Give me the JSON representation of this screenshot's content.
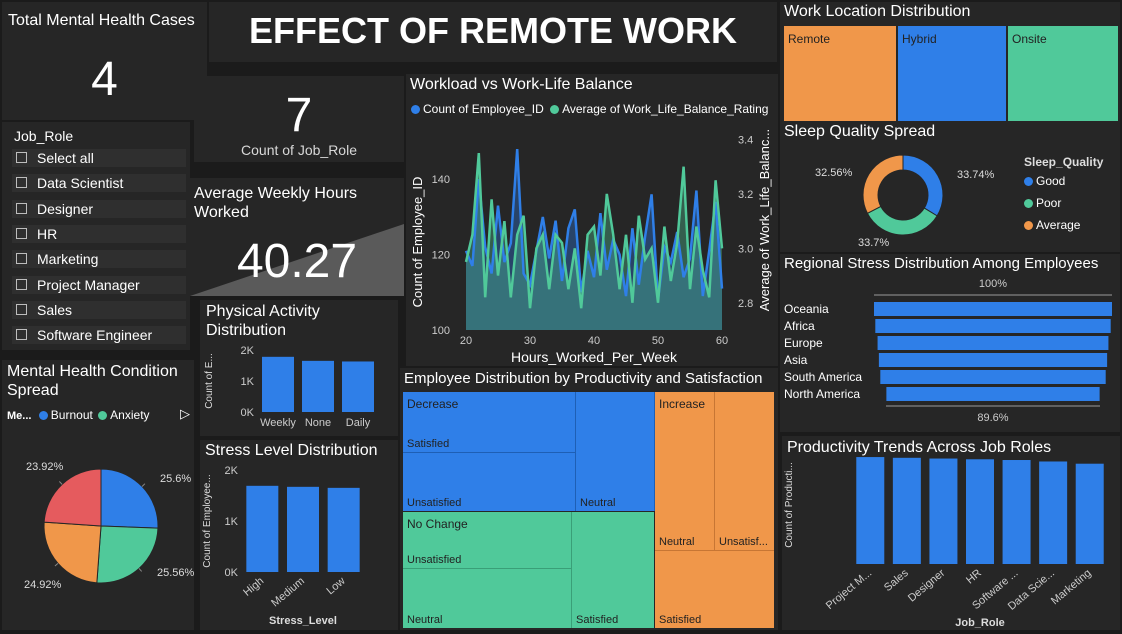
{
  "colors": {
    "blue": "#2f7fe8",
    "green": "#50c99a",
    "orange": "#f0974a",
    "red": "#e55b5e"
  },
  "header": {
    "title": "EFFECT OF REMOTE WORK"
  },
  "kpi_cases": {
    "label": "Total Mental Health Cases",
    "value": "4"
  },
  "kpi_roles": {
    "value": "7",
    "label": "Count of Job_Role"
  },
  "kpi_hours": {
    "label": "Average Weekly Hours Worked",
    "value": "40.27"
  },
  "slicer": {
    "title": "Job_Role",
    "items": [
      "Select all",
      "Data Scientist",
      "Designer",
      "HR",
      "Marketing",
      "Project Manager",
      "Sales",
      "Software Engineer"
    ]
  },
  "mental_health": {
    "title": "Mental Health Condition Spread",
    "legend_title": "Me...",
    "legend": [
      "Burnout",
      "Anxiety"
    ],
    "chart_data": {
      "type": "pie",
      "labels": [
        "25.6%",
        "25.56%",
        "24.92%",
        "23.92%"
      ],
      "values": [
        25.6,
        25.56,
        24.92,
        23.92
      ],
      "colors": [
        "#2f7fe8",
        "#50c99a",
        "#f0974a",
        "#e55b5e"
      ]
    }
  },
  "physical": {
    "title": "Physical Activity Distribution",
    "chart_data": {
      "type": "bar",
      "categories": [
        "Weekly",
        "None",
        "Daily"
      ],
      "values": [
        1780,
        1650,
        1630
      ],
      "ylabel": "Count of E...",
      "yticks": [
        "0K",
        "1K",
        "2K"
      ],
      "ylim": [
        0,
        2000
      ]
    }
  },
  "stress": {
    "title": "Stress Level Distribution",
    "chart_data": {
      "type": "bar",
      "categories": [
        "High",
        "Medium",
        "Low"
      ],
      "values": [
        1690,
        1670,
        1650
      ],
      "xlabel": "Stress_Level",
      "ylabel": "Count of Employee...",
      "yticks": [
        "0K",
        "1K",
        "2K"
      ],
      "ylim": [
        0,
        2000
      ]
    }
  },
  "workload": {
    "title": "Workload vs Work-Life Balance",
    "legend": [
      "Count of Employee_ID",
      "Average of Work_Life_Balance_Rating"
    ],
    "chart_data": {
      "type": "line",
      "x": [
        20,
        21,
        22,
        23,
        24,
        25,
        26,
        27,
        28,
        29,
        30,
        31,
        32,
        33,
        34,
        35,
        36,
        37,
        38,
        39,
        40,
        41,
        42,
        43,
        44,
        45,
        46,
        47,
        48,
        49,
        50,
        51,
        52,
        53,
        54,
        55,
        56,
        57,
        58,
        59,
        60
      ],
      "series": [
        {
          "name": "Count of Employee_ID",
          "axis": "left",
          "values": [
            121,
            117,
            140,
            122,
            115,
            133,
            118,
            123,
            148,
            115,
            112,
            121,
            130,
            119,
            129,
            113,
            127,
            132,
            110,
            121,
            114,
            131,
            116,
            124,
            120,
            109,
            127,
            112,
            125,
            136,
            108,
            122,
            118,
            126,
            114,
            119,
            137,
            109,
            121,
            134,
            111
          ]
        },
        {
          "name": "Average of Work_Life_Balance_Rating",
          "axis": "right",
          "values": [
            2.95,
            3.05,
            3.35,
            2.82,
            3.18,
            2.9,
            3.1,
            2.82,
            3.05,
            3.12,
            2.78,
            3.0,
            3.05,
            2.85,
            3.05,
            3.02,
            2.85,
            3.0,
            2.78,
            3.05,
            3.08,
            2.9,
            3.2,
            3.05,
            2.85,
            3.05,
            2.8,
            3.12,
            2.96,
            3.0,
            2.8,
            3.08,
            2.88,
            3.02,
            3.3,
            2.85,
            3.08,
            2.92,
            2.82,
            3.25,
            3.0
          ]
        }
      ],
      "xlabel": "Hours_Worked_Per_Week",
      "ylabel": "Count of Employee_ID",
      "y2label": "Average of Work_Life_Balanc...",
      "xticks": [
        20,
        30,
        40,
        50,
        60
      ],
      "yticks": [
        100,
        120,
        140
      ],
      "y2ticks": [
        2.8,
        3.0,
        3.2,
        3.4
      ],
      "ylim": [
        100,
        152
      ],
      "y2lim": [
        2.7,
        3.42
      ]
    }
  },
  "productivity_satisfaction": {
    "title": "Employee Distribution by Productivity and Satisfaction",
    "tiles": [
      {
        "group": "Decrease",
        "labels": [
          "Satisfied",
          "Unsatisfied",
          "Neutral"
        ]
      },
      {
        "group": "No Change",
        "labels": [
          "Unsatisfied",
          "Neutral",
          "Satisfied"
        ]
      },
      {
        "group": "Increase",
        "labels": [
          "Neutral",
          "Unsatisf...",
          "Satisfied"
        ]
      }
    ]
  },
  "work_location": {
    "title": "Work Location Distribution",
    "chart_data": {
      "type": "heatmap",
      "categories": [
        "Remote",
        "Hybrid",
        "Onsite"
      ]
    }
  },
  "sleep": {
    "title": "Sleep Quality Spread",
    "legend_title": "Sleep_Quality",
    "legend": [
      "Good",
      "Poor",
      "Average"
    ],
    "chart_data": {
      "type": "pie",
      "labels": [
        "33.74%",
        "33.7%",
        "32.56%"
      ],
      "values": [
        33.74,
        33.7,
        32.56
      ],
      "colors": [
        "#2f7fe8",
        "#50c99a",
        "#f0974a"
      ]
    }
  },
  "regional": {
    "title": "Regional Stress Distribution Among Employees",
    "top_label": "100%",
    "bottom_label": "89.6%",
    "chart_data": {
      "type": "bar",
      "categories": [
        "Oceania",
        "Africa",
        "Europe",
        "Asia",
        "South America",
        "North America"
      ],
      "values": [
        100,
        98.9,
        97.0,
        95.9,
        94.7,
        89.6
      ]
    }
  },
  "job_trends": {
    "title": "Productivity Trends Across Job Roles",
    "chart_data": {
      "type": "bar",
      "categories": [
        "Project M...",
        "Sales",
        "Designer",
        "HR",
        "Software ...",
        "Data Scie...",
        "Marketing"
      ],
      "values": [
        725,
        720,
        715,
        710,
        705,
        695,
        680
      ],
      "xlabel": "Job_Role",
      "ylabel": "Count of Producti...",
      "yticks": [
        "500"
      ],
      "ylim": [
        0,
        800
      ]
    }
  }
}
